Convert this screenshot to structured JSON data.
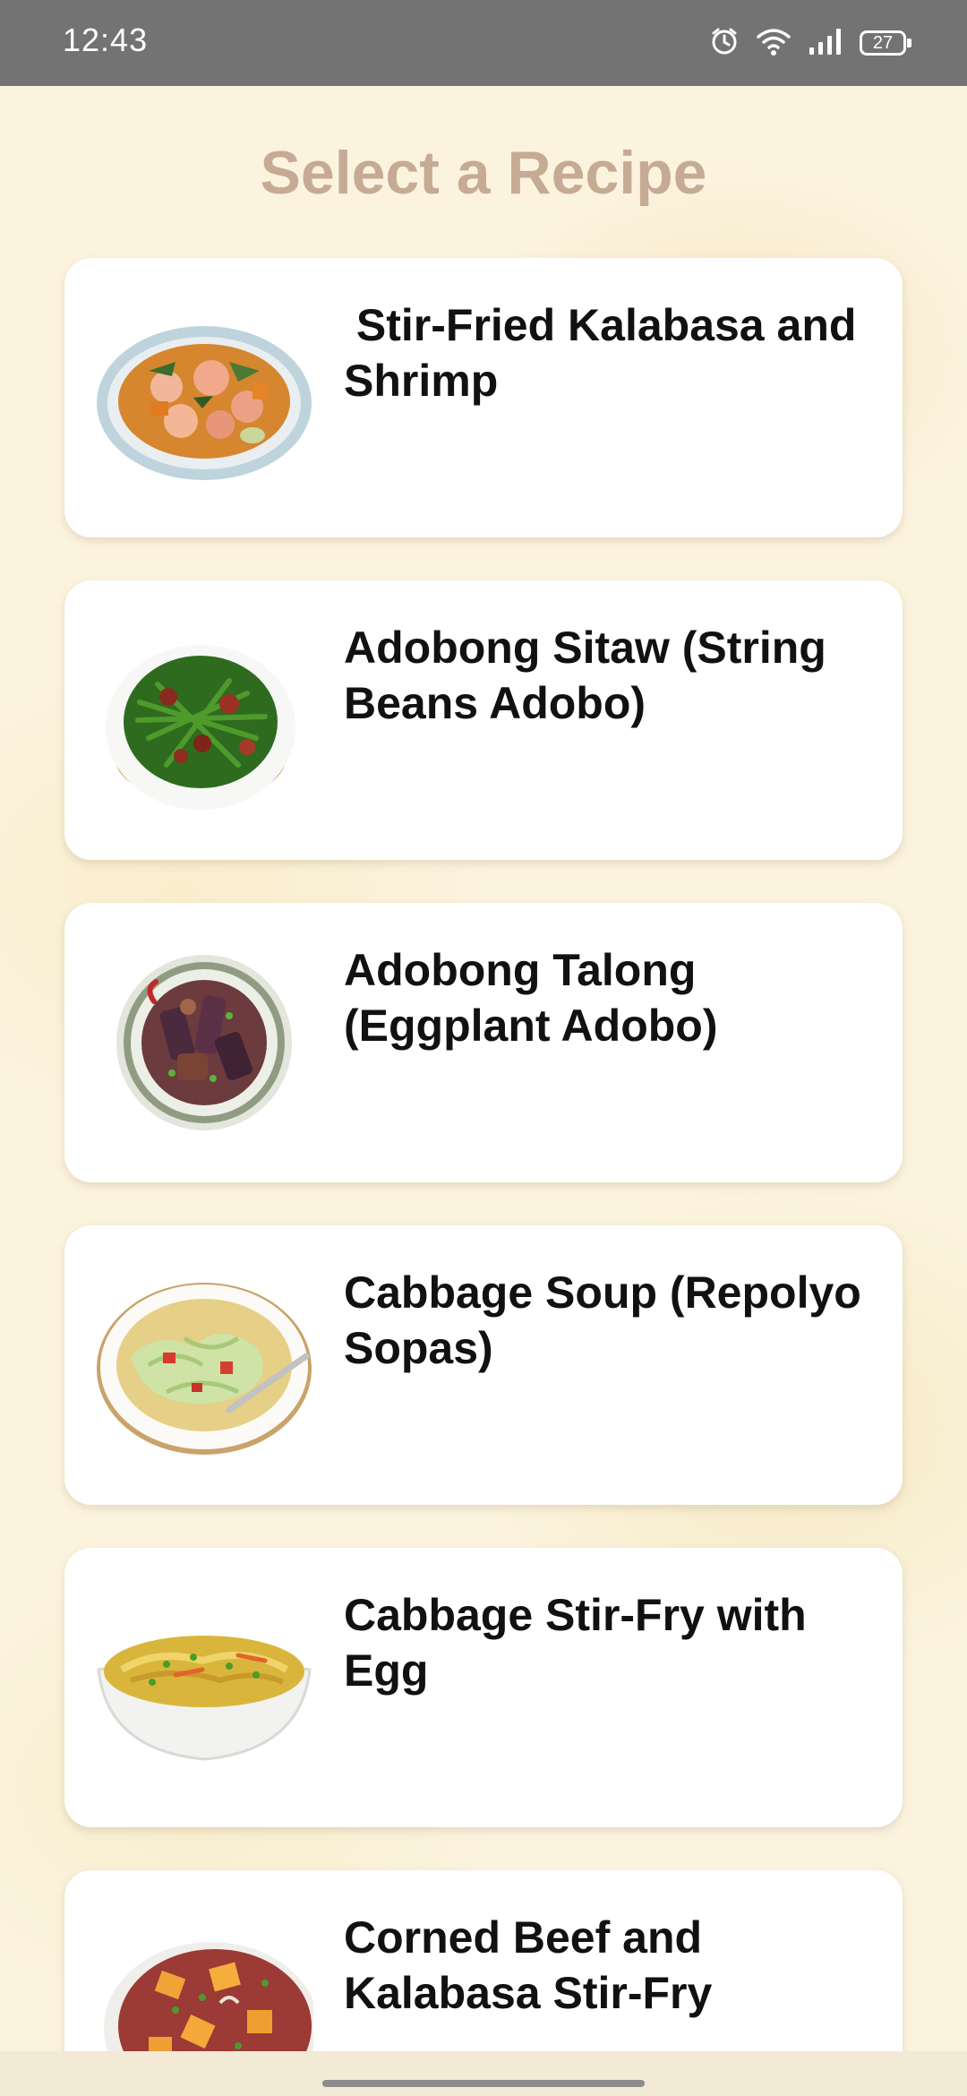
{
  "status_bar": {
    "time": "12:43",
    "battery": "27",
    "icons": [
      "alarm-icon",
      "wifi-icon",
      "signal-icon",
      "battery-icon"
    ]
  },
  "page": {
    "title": "Select a Recipe"
  },
  "recipes": [
    {
      "title": " Stir-Fried Kalabasa and Shrimp",
      "image": "shrimp-kalabasa-plate"
    },
    {
      "title": "Adobong Sitaw (String Beans Adobo)",
      "image": "string-beans-bowl"
    },
    {
      "title": "Adobong Talong (Eggplant Adobo)",
      "image": "eggplant-plate"
    },
    {
      "title": "Cabbage Soup (Repolyo Sopas)",
      "image": "cabbage-soup-bowl"
    },
    {
      "title": "Cabbage Stir-Fry with Egg",
      "image": "cabbage-egg-bowl"
    },
    {
      "title": "Corned Beef and Kalabasa Stir-Fry",
      "image": "corned-beef-kalabasa-plate"
    }
  ],
  "colors": {
    "status_bar": "#737373",
    "title": "#c6ab94",
    "background": "#fcf3df",
    "card": "#ffffff"
  }
}
